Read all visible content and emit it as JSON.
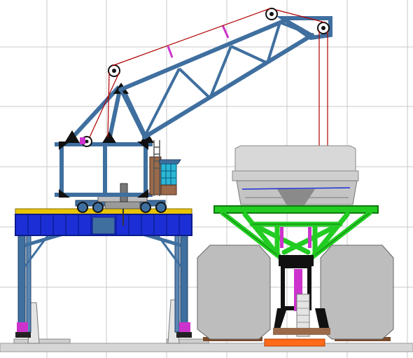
{
  "scene": {
    "description_free": true,
    "colors": {
      "background": "#ffffff",
      "grid": "#c8c8c8",
      "crane_steel": "#3f6f9f",
      "crane_steel_dark": "#1f3f66",
      "portal_blue": "#1c2fd6",
      "portal_dark": "#0a1a8a",
      "walkway_yellow": "#e8c400",
      "green_frame": "#22cc22",
      "green_dark": "#0e7a0e",
      "hopper_grey": "#cfcfcf",
      "hopper_dark": "#8a8a8a",
      "wagon_grey": "#bdbdbd",
      "cable_red": "#b00000",
      "black_detail": "#111111",
      "magenta_detail": "#cc33cc",
      "cabin_cyan": "#2bb7d6",
      "brick": "#9a6a4a",
      "base_orange": "#ff6a1a",
      "ground": "#d6d6d6",
      "rail_brown": "#7a4a2a"
    }
  }
}
